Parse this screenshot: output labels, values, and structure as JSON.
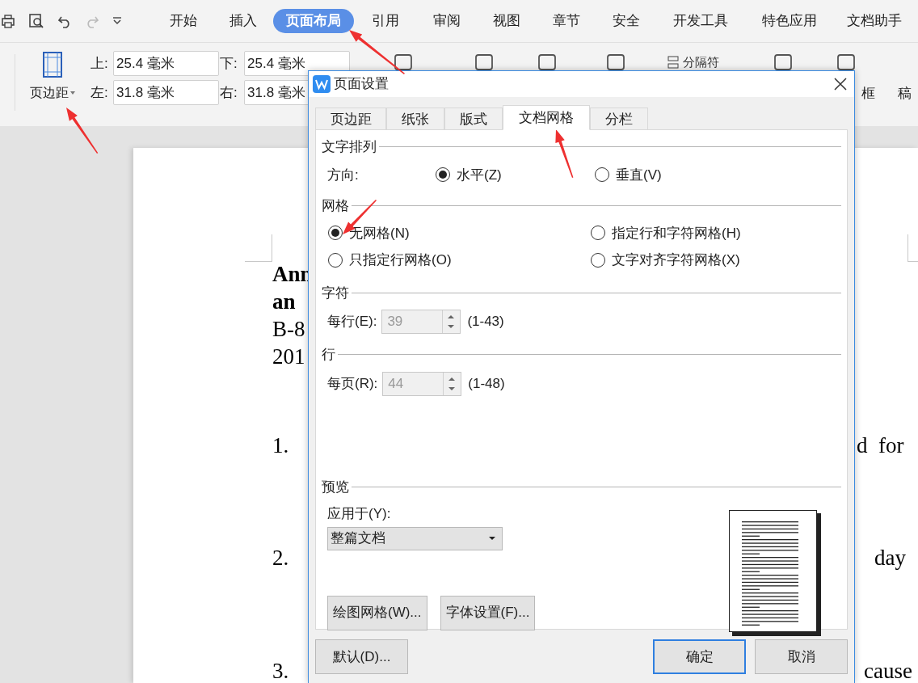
{
  "menu_tabs": [
    {
      "label": "开始",
      "selected": false
    },
    {
      "label": "插入",
      "selected": false
    },
    {
      "label": "页面布局",
      "selected": true
    },
    {
      "label": "引用",
      "selected": false
    },
    {
      "label": "审阅",
      "selected": false
    },
    {
      "label": "视图",
      "selected": false
    },
    {
      "label": "章节",
      "selected": false
    },
    {
      "label": "安全",
      "selected": false
    },
    {
      "label": "开发工具",
      "selected": false
    },
    {
      "label": "特色应用",
      "selected": false
    },
    {
      "label": "文档助手",
      "selected": false
    }
  ],
  "ribbon": {
    "margins_button": "页边距",
    "margin_fields": [
      {
        "label": "上:",
        "value": "25.4 毫米"
      },
      {
        "label": "下:",
        "value": "25.4 毫米"
      },
      {
        "label": "左:",
        "value": "31.8 毫米"
      },
      {
        "label": "右:",
        "value": "31.8 毫米"
      }
    ],
    "breaks_button": "分隔符",
    "page_border_label": "框",
    "paper_label": "稿"
  },
  "document": {
    "heading_lines": [
      "Ann",
      "an",
      "B-8",
      "201"
    ],
    "list_numbers": [
      "1.",
      "2.",
      "3."
    ],
    "right_fragments": [
      "d  for",
      "day",
      "cause"
    ]
  },
  "dialog": {
    "title": "页面设置",
    "tabs": [
      {
        "label": "页边距",
        "selected": false
      },
      {
        "label": "纸张",
        "selected": false
      },
      {
        "label": "版式",
        "selected": false
      },
      {
        "label": "文档网格",
        "selected": true
      },
      {
        "label": "分栏",
        "selected": false
      }
    ],
    "text_direction": {
      "heading": "文字排列",
      "label": "方向:",
      "options": [
        {
          "label": "水平(Z)",
          "selected": true
        },
        {
          "label": "垂直(V)",
          "selected": false
        }
      ]
    },
    "grid": {
      "heading": "网格",
      "options": [
        {
          "label": "无网格(N)",
          "selected": true
        },
        {
          "label": "指定行和字符网格(H)",
          "selected": false
        },
        {
          "label": "只指定行网格(O)",
          "selected": false
        },
        {
          "label": "文字对齐字符网格(X)",
          "selected": false
        }
      ]
    },
    "characters": {
      "heading": "字符",
      "label": "每行(E):",
      "value": "39",
      "range": "(1-43)",
      "disabled": true
    },
    "lines": {
      "heading": "行",
      "label": "每页(R):",
      "value": "44",
      "range": "(1-48)",
      "disabled": true
    },
    "preview": {
      "heading": "预览",
      "apply_label": "应用于(Y):",
      "apply_value": "整篇文档",
      "buttons": [
        "绘图网格(W)...",
        "字体设置(F)..."
      ]
    },
    "footer": {
      "default_button": "默认(D)...",
      "ok_button": "确定",
      "cancel_button": "取消"
    }
  }
}
